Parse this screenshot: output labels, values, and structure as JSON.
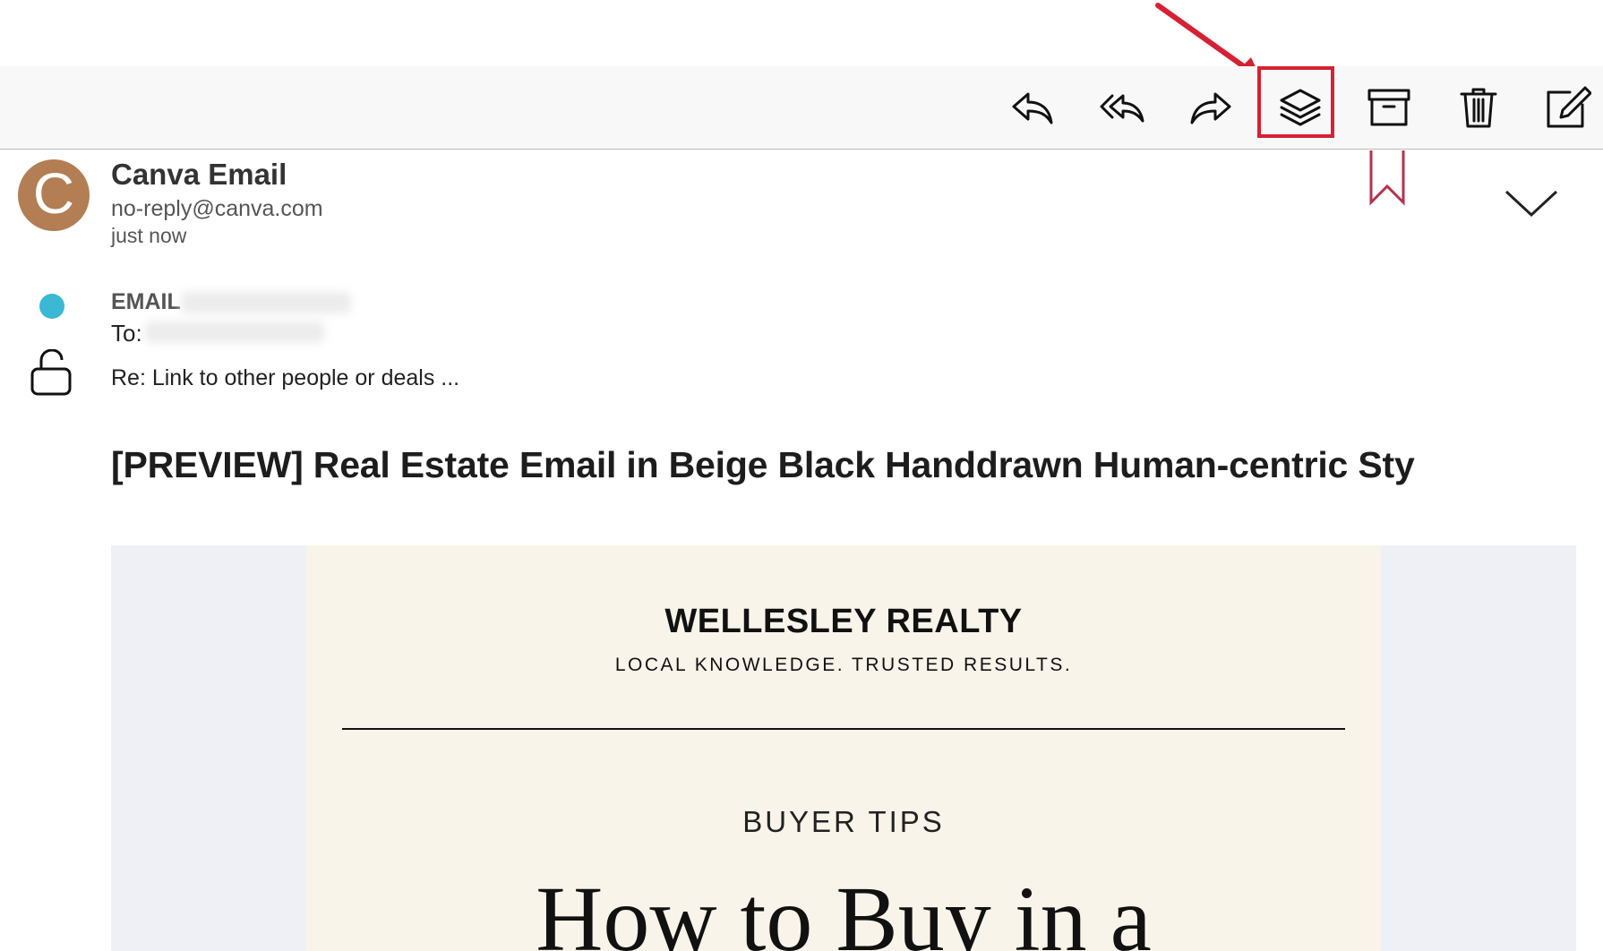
{
  "toolbar": {
    "actions": [
      {
        "name": "reply",
        "icon": "reply-icon"
      },
      {
        "name": "reply-all",
        "icon": "reply-all-icon"
      },
      {
        "name": "forward",
        "icon": "forward-icon"
      },
      {
        "name": "layers",
        "icon": "layers-icon"
      },
      {
        "name": "archive",
        "icon": "archive-icon"
      },
      {
        "name": "delete",
        "icon": "trash-icon"
      },
      {
        "name": "compose",
        "icon": "compose-icon"
      }
    ],
    "highlight_color": "#d62134"
  },
  "message": {
    "avatar_letter": "C",
    "avatar_color": "#b37e53",
    "sender_name": "Canva Email",
    "sender_email": "no-reply@canva.com",
    "time": "just now",
    "from_label": "EMAIL",
    "to_label": "To:",
    "re_line": "Re:  Link to other people or deals ...",
    "subject": "[PREVIEW] Real Estate Email in Beige Black Handdrawn Human-centric Sty",
    "status_dot_color": "#3ab8d4"
  },
  "email_preview": {
    "brand": "WELLESLEY REALTY",
    "tagline": "LOCAL KNOWLEDGE. TRUSTED RESULTS.",
    "section": "BUYER TIPS",
    "headline": "How to Buy in a",
    "card_background": "#f8f4e9",
    "outer_background": "#eef0f5"
  }
}
